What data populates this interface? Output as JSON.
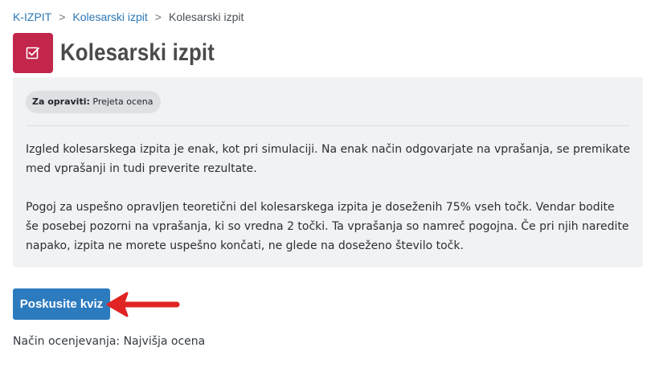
{
  "breadcrumb": {
    "items": [
      {
        "label": "K-IZPIT"
      },
      {
        "label": "Kolesarski izpit"
      },
      {
        "label": "Kolesarski izpit"
      }
    ],
    "separator": ">"
  },
  "page": {
    "title": "Kolesarski izpit",
    "icon": "quiz-checkbox-icon",
    "icon_color": "#c2264b"
  },
  "completion": {
    "label": "Za opraviti:",
    "value": "Prejeta ocena"
  },
  "description": {
    "paragraph1": "Izgled kolesarskega izpita je enak, kot pri simulaciji. Na enak način odgovarjate na vprašanja, se premikate med vprašanji in tudi preverite rezultate.",
    "paragraph2": "Pogoj za uspešno opravljen teoretični del kolesarskega izpita je doseženih 75% vseh točk. Vendar bodite še posebej pozorni na vprašanja, ki so vredna 2 točki. Ta vprašanja so namreč pogojna. Če pri njih naredite napako, izpita ne morete uspešno končati, ne glede na  doseženo število točk."
  },
  "actions": {
    "attempt_label": "Poskusite kviz",
    "attempt_color": "#2d7bbf"
  },
  "annotation": {
    "arrow_color": "#e02424"
  },
  "grading": {
    "text": "Način ocenjevanja: Najvišja ocena"
  }
}
